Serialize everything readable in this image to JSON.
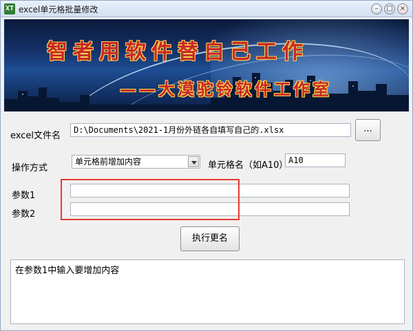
{
  "window": {
    "title": "excel单元格批量修改",
    "app_icon": "XT",
    "buttons": {
      "minimize_icon": "minimize-icon",
      "maximize_icon": "maximize-icon",
      "close_icon": "close-icon"
    }
  },
  "banner": {
    "slogan_main": "智者用软件替自己工作",
    "slogan_sub": "——大漠驼铃软件工作室"
  },
  "form": {
    "file_label": "excel文件名",
    "file_value": "D:\\Documents\\2021-1月份外链各自填写自己的.xlsx",
    "browse_label": "...",
    "mode_label": "操作方式",
    "mode_selected": "单元格前增加内容",
    "cell_label": "单元格名（如A10）",
    "cell_value": "A10",
    "param1_label": "参数1",
    "param1_value": "",
    "param2_label": "参数2",
    "param2_value": "",
    "run_label": "执行更名"
  },
  "output": {
    "text": "在参数1中输入要增加内容"
  },
  "colors": {
    "highlight_border": "#e53935",
    "slogan": "#c62828",
    "slogan_outline": "#ffd54f"
  }
}
